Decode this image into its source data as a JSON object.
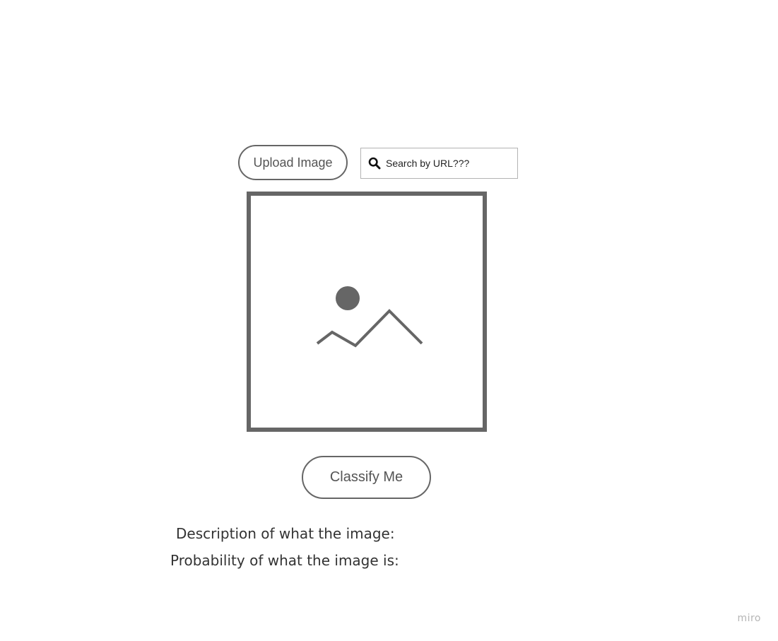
{
  "upload_button": {
    "label": "Upload Image"
  },
  "search": {
    "placeholder": "Search by URL???",
    "icon": "search-icon"
  },
  "preview": {
    "icon": "image-placeholder-icon"
  },
  "classify_button": {
    "label": "Classify Me"
  },
  "results": {
    "description_label": "Description of what the image:",
    "probability_label": "Probability of what the image is:"
  },
  "watermark": {
    "text": "miro"
  },
  "colors": {
    "outline": "#666666",
    "search_border": "#b3b3b3",
    "text": "#333333",
    "watermark": "#b5b5b5"
  }
}
